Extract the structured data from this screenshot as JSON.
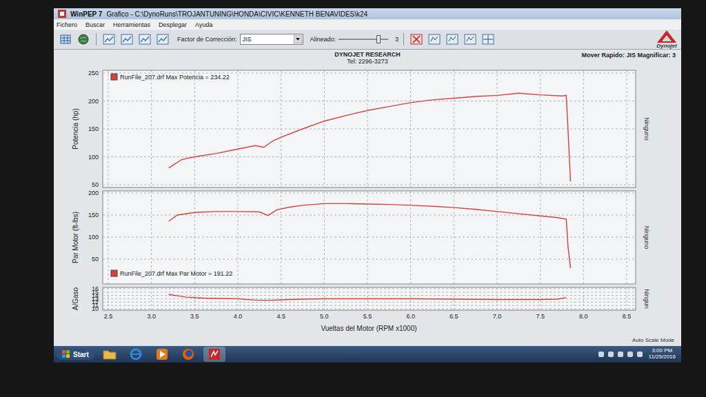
{
  "window": {
    "app": "WinPEP 7",
    "title": "Grafico - C:\\DynoRuns\\TROJANTUNING\\HONDA\\CIVIC\\KENNETH BENAVIDES\\k24"
  },
  "menu": [
    "Fichero",
    "Buscar",
    "Herramientas",
    "Desplegar",
    "Ayuda"
  ],
  "toolbar": {
    "correction_label": "Factor de Corrección:",
    "correction_value": "JIS",
    "align_label": "Alineado:",
    "align_value": "3",
    "align_level": 0.8
  },
  "logo": "Dynojet",
  "header": {
    "company": "DYNOJET RESEARCH",
    "phone": "Tel: 2296-3273",
    "status": "Mover Rapido: JIS  Magnificar: 3"
  },
  "chart": {
    "x_ticks": [
      "2.5",
      "3.0",
      "3.5",
      "4.0",
      "4.5",
      "5.0",
      "5.5",
      "6.0",
      "6.5",
      "7.0",
      "7.5",
      "8.0",
      "8.5"
    ],
    "x_title": "Vueltas del Motor (RPM x1000)",
    "panels": [
      {
        "y_title": "Potencia (hp)",
        "y_ticks": [
          "250",
          "200",
          "150",
          "100",
          "50"
        ],
        "y_min": 50,
        "y_max": 250,
        "right_label": "Ninguno",
        "legend": "RunFile_207.drf Max Potencia = 234.22",
        "color": "#d9403a",
        "rpm": [
          3.2,
          3.35,
          3.5,
          3.75,
          4.0,
          4.2,
          4.3,
          4.4,
          4.5,
          4.75,
          5.0,
          5.25,
          5.5,
          5.75,
          6.0,
          6.25,
          6.5,
          6.75,
          7.0,
          7.25,
          7.5,
          7.75,
          7.8,
          7.82,
          7.85
        ],
        "values": [
          80,
          95,
          100,
          106,
          114,
          120,
          117,
          128,
          135,
          150,
          164,
          174,
          183,
          190,
          197,
          202,
          205,
          208,
          210,
          214,
          211,
          209,
          210,
          150,
          56
        ]
      },
      {
        "y_title": "Par Motor (ft-lbs)",
        "y_ticks": [
          "200",
          "150",
          "100",
          "50"
        ],
        "y_min": 0,
        "y_max": 200,
        "right_label": "Ninguno",
        "legend": "RunFile_207.drf Max Par Motor = 191.22",
        "color": "#d9403a",
        "rpm": [
          3.2,
          3.3,
          3.5,
          3.75,
          4.0,
          4.25,
          4.35,
          4.45,
          4.6,
          4.75,
          5.0,
          5.25,
          5.5,
          5.75,
          6.0,
          6.25,
          6.5,
          6.75,
          7.0,
          7.25,
          7.5,
          7.7,
          7.8,
          7.82,
          7.85
        ],
        "values": [
          136,
          150,
          156,
          158,
          158,
          157,
          149,
          162,
          168,
          172,
          176,
          176,
          175,
          174,
          172,
          170,
          167,
          163,
          158,
          153,
          148,
          144,
          141,
          80,
          30
        ]
      },
      {
        "y_title": "A/Gaso",
        "y_ticks": [
          "16",
          "15",
          "14",
          "13",
          "12",
          "11",
          "10"
        ],
        "y_min": 10,
        "y_max": 16,
        "right_label": "Ningun",
        "color": "#d9403a",
        "rpm": [
          3.2,
          3.4,
          3.6,
          4.0,
          4.2,
          4.35,
          4.6,
          5.0,
          5.5,
          6.0,
          6.5,
          7.0,
          7.5,
          7.7,
          7.8
        ],
        "values": [
          14.3,
          13.5,
          13.2,
          13.0,
          12.6,
          12.5,
          12.8,
          13.0,
          13.0,
          13.0,
          12.9,
          12.8,
          12.8,
          12.9,
          13.4
        ]
      }
    ]
  },
  "status": "Auto Scale Mode",
  "taskbar": {
    "start": "Start",
    "time": "3:00 PM",
    "date": "11/25/2016"
  }
}
